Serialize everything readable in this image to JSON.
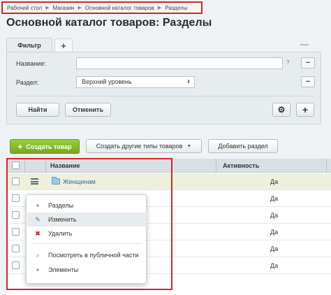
{
  "breadcrumb": [
    "Рабочий стол",
    "Магазин",
    "Основной каталог товаров",
    "Разделы"
  ],
  "page_title": "Основной каталог товаров: Разделы",
  "filter": {
    "tab_label": "Фильтр",
    "name_label": "Название:",
    "section_label": "Раздел:",
    "section_value": "Верхний уровень",
    "help_mark": "?",
    "find_button": "Найти",
    "cancel_button": "Отменить"
  },
  "toolbar": {
    "create_product": "Создать товар",
    "create_other": "Создать другие типы товаров",
    "add_section": "Добавить раздел"
  },
  "grid": {
    "columns": [
      "Название",
      "Активность"
    ],
    "rows": [
      {
        "name": "Женщинам",
        "active": "Да"
      },
      {
        "name": "",
        "active": "Да"
      },
      {
        "name": "",
        "active": "Да"
      },
      {
        "name": "",
        "active": "Да"
      },
      {
        "name": "",
        "active": "Да"
      },
      {
        "name": "",
        "active": "Да"
      }
    ]
  },
  "context_menu": [
    {
      "label": "Разделы",
      "icon": "dot-icon"
    },
    {
      "label": "Изменить",
      "icon": "edit-icon"
    },
    {
      "label": "Удалить",
      "icon": "delete-icon"
    },
    {
      "label": "Посмотреть в публичной части",
      "icon": "preview-icon"
    },
    {
      "label": "Элементы",
      "icon": "dot-icon"
    }
  ],
  "colors": {
    "highlight_frame": "#d9222a",
    "create_button": "#84b82a",
    "link": "#2d6da3"
  }
}
